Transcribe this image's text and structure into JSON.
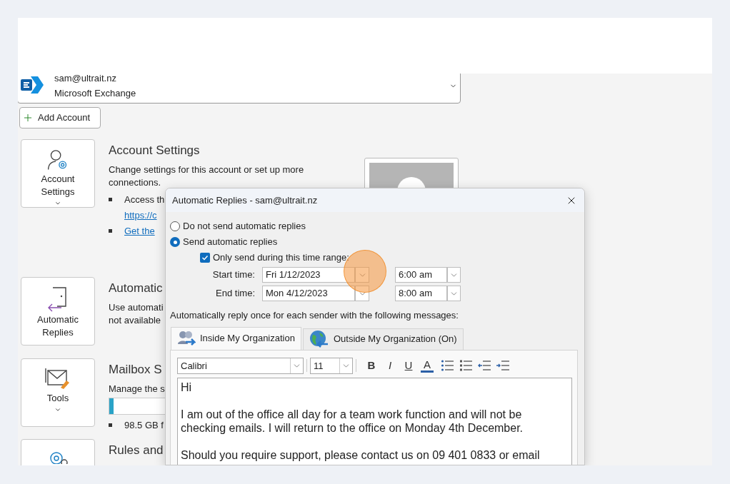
{
  "account": {
    "email": "sam@ultrait.nz",
    "type": "Microsoft Exchange"
  },
  "add_account": "Add Account",
  "sections": [
    {
      "kind": "account",
      "button": "Account Settings",
      "has_menu": true,
      "title": "Account Settings",
      "description_lines": [
        "Change settings for this account or set up more",
        "connections."
      ],
      "bullets": [
        {
          "parts": [
            {
              "kind": "text",
              "text": "Access th"
            },
            {
              "kind": "link",
              "text": "https://c"
            }
          ]
        },
        {
          "parts": [
            {
              "kind": "link",
              "text": "Get the"
            }
          ]
        }
      ],
      "profile_picture": true
    },
    {
      "kind": "replies",
      "button": "Automatic Replies",
      "has_menu": false,
      "title": "Automatic",
      "description_lines": [
        "Use automati",
        "not available"
      ]
    },
    {
      "kind": "tools",
      "button": "Tools",
      "has_menu": true,
      "title": "Mailbox S",
      "description_lines": [
        "Manage the s"
      ],
      "meter": {
        "level": 0.03
      },
      "bullets": [
        {
          "parts": [
            {
              "kind": "text",
              "text": "98.5 GB f"
            }
          ]
        }
      ]
    },
    {
      "kind": "rules",
      "title": "Rules and"
    }
  ],
  "dialog": {
    "title": "Automatic Replies - sam@ultrait.nz",
    "options": [
      {
        "label": "Do not send automatic replies",
        "selected": false
      },
      {
        "label": "Send automatic replies",
        "selected": true
      }
    ],
    "time_range": {
      "label": "Only send during this time range:",
      "checked": true
    },
    "times": [
      {
        "label": "Start time:",
        "date": "Fri 1/12/2023",
        "time": "6:00 am"
      },
      {
        "label": "End time:",
        "date": "Mon 4/12/2023",
        "time": "8:00 am"
      }
    ],
    "reply_label": "Automatically reply once for each sender with the following messages:",
    "tabs": [
      {
        "kind": "inside",
        "label": "Inside My Organization",
        "selected": true
      },
      {
        "kind": "outside",
        "label": "Outside My Organization (On)",
        "selected": false
      }
    ],
    "font": "Calibri",
    "size": "11",
    "format_buttons": [
      {
        "kind": "bold",
        "text": "B"
      },
      {
        "kind": "italic",
        "text": "I"
      },
      {
        "kind": "underline",
        "text": "U"
      },
      {
        "kind": "color",
        "text": "A"
      }
    ],
    "message_paragraphs": [
      "Hi",
      "I am out of the office all day for a team work function and will not be checking emails. I will return to the office on Monday 4th December.",
      "Should you require support, please contact us on 09 401 0833 or email"
    ]
  }
}
